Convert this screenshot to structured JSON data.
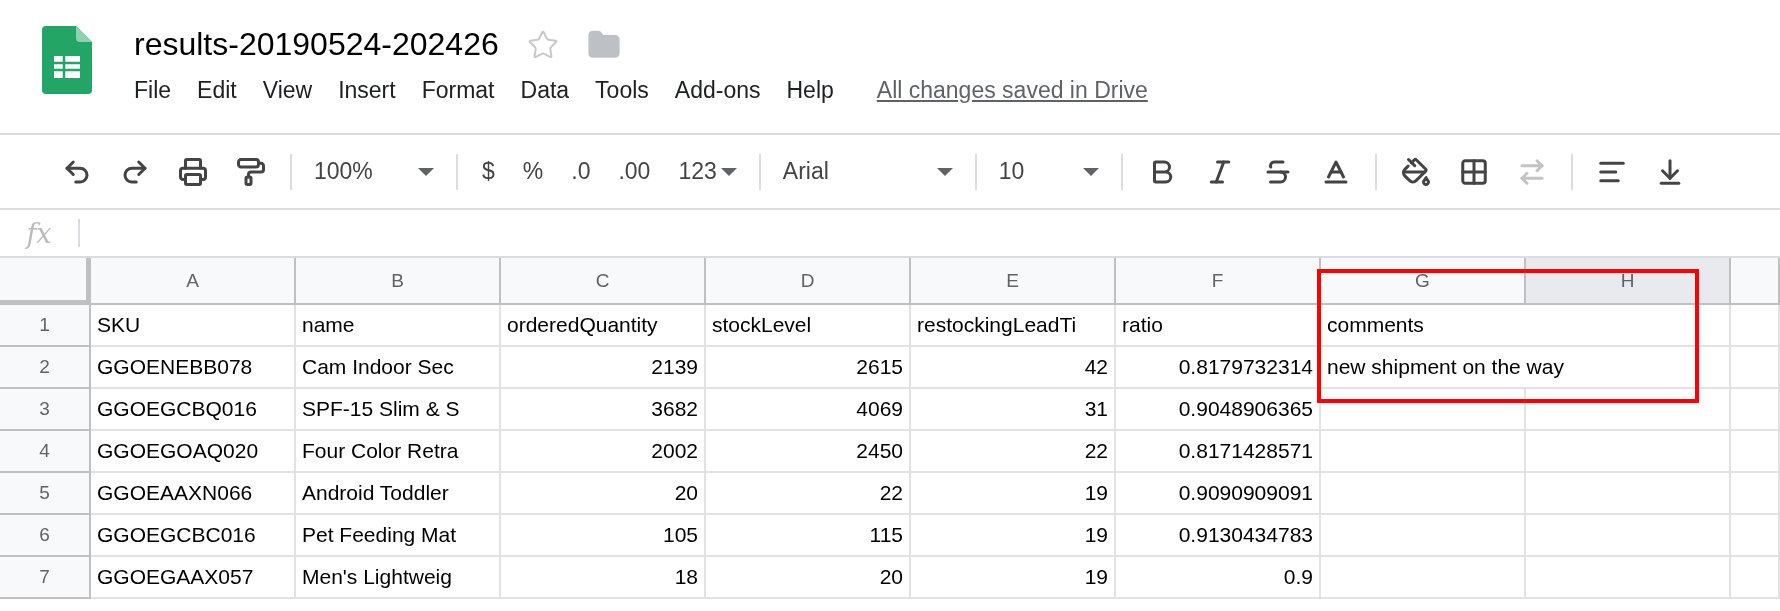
{
  "document": {
    "title": "results-20190524-202426",
    "starred": false
  },
  "menu": [
    {
      "label": "File"
    },
    {
      "label": "Edit"
    },
    {
      "label": "View"
    },
    {
      "label": "Insert"
    },
    {
      "label": "Format"
    },
    {
      "label": "Data"
    },
    {
      "label": "Tools"
    },
    {
      "label": "Add-ons"
    },
    {
      "label": "Help"
    }
  ],
  "save_status": "All changes saved in Drive",
  "toolbar": {
    "zoom": "100%",
    "number_formats": [
      "$",
      "%",
      ".0",
      ".00",
      "123"
    ],
    "font": "Arial",
    "font_size": "10"
  },
  "formula_bar": {
    "label": "fx"
  },
  "columns": [
    {
      "label": "A",
      "kind": "text",
      "selected": false
    },
    {
      "label": "B",
      "kind": "text",
      "selected": false
    },
    {
      "label": "C",
      "kind": "number",
      "selected": false
    },
    {
      "label": "D",
      "kind": "number",
      "selected": false
    },
    {
      "label": "E",
      "kind": "number",
      "selected": false
    },
    {
      "label": "F",
      "kind": "number",
      "selected": false
    },
    {
      "label": "G",
      "kind": "text",
      "selected": false
    },
    {
      "label": "H",
      "kind": "text",
      "selected": true
    }
  ],
  "rows": [
    {
      "number": "1",
      "kind": "header",
      "cells": [
        "SKU",
        "name",
        "orderedQuantity",
        "stockLevel",
        "restockingLeadTi",
        "ratio",
        "comments",
        ""
      ]
    },
    {
      "number": "2",
      "kind": "data",
      "cells": [
        "GGOENEBB078",
        "Cam Indoor Sec",
        "2139",
        "2615",
        "42",
        "0.8179732314",
        "new shipment on the way",
        ""
      ]
    },
    {
      "number": "3",
      "kind": "data",
      "cells": [
        "GGOEGCBQ016",
        "SPF-15 Slim & S",
        "3682",
        "4069",
        "31",
        "0.9048906365",
        "",
        ""
      ]
    },
    {
      "number": "4",
      "kind": "data",
      "cells": [
        "GGOEGOAQ020",
        "Four Color Retra",
        "2002",
        "2450",
        "22",
        "0.8171428571",
        "",
        ""
      ]
    },
    {
      "number": "5",
      "kind": "data",
      "cells": [
        "GGOEAAXN066",
        "Android Toddler",
        "20",
        "22",
        "19",
        "0.9090909091",
        "",
        ""
      ]
    },
    {
      "number": "6",
      "kind": "data",
      "cells": [
        "GGOEGCBC016",
        "Pet Feeding Mat",
        "105",
        "115",
        "19",
        "0.9130434783",
        "",
        ""
      ]
    },
    {
      "number": "7",
      "kind": "data",
      "cells": [
        "GGOEGAAX057",
        "Men's Lightweig",
        "18",
        "20",
        "19",
        "0.9",
        "",
        ""
      ]
    }
  ]
}
